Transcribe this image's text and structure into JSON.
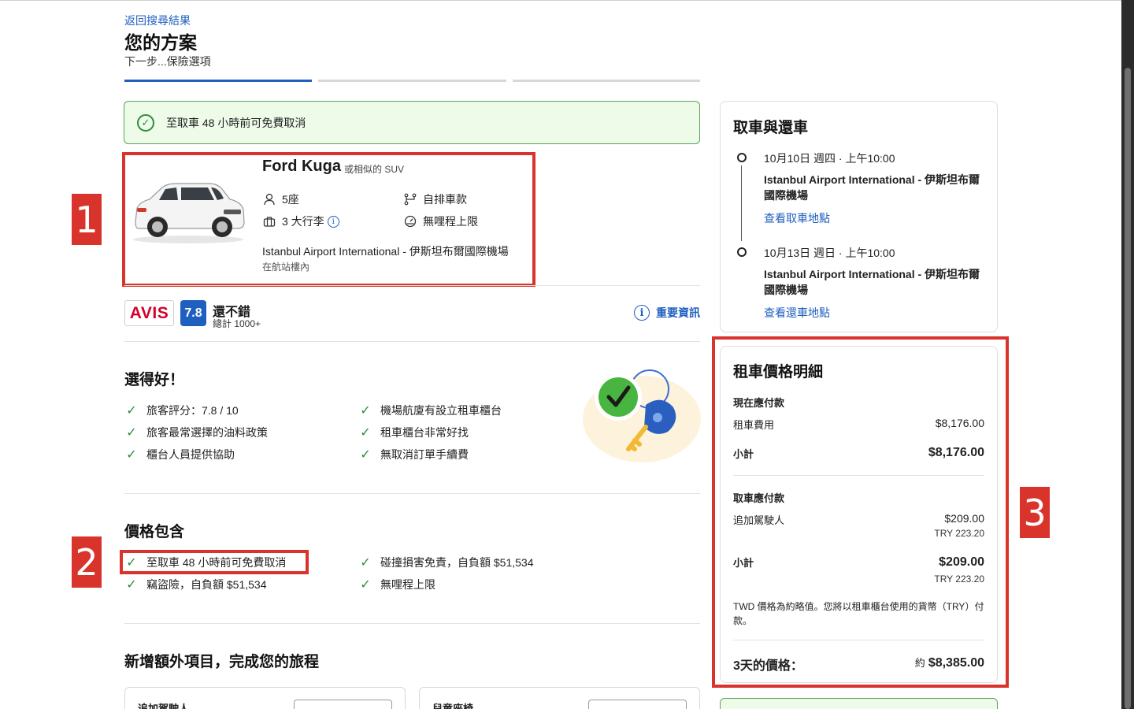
{
  "header": {
    "back_link": "返回搜尋結果",
    "title": "您的方案",
    "next_step": "下一步...保險選項"
  },
  "banner": {
    "text": "至取車 48 小時前可免費取消"
  },
  "car": {
    "name": "Ford Kuga",
    "similar": "或相似的 SUV",
    "seats": "5座",
    "transmission": "自排車款",
    "luggage": "3 大行李",
    "mileage": "無哩程上限",
    "location": "Istanbul Airport International - 伊斯坦布爾國際機場",
    "location_sub": "在航站樓內"
  },
  "supplier": {
    "logo_text": "AVIS",
    "score": "7.8",
    "score_label": "還不錯",
    "review_count": "總計 1000+",
    "important_info": "重要資訊"
  },
  "good_choice": {
    "title": "選得好！",
    "items_left": [
      "旅客評分：7.8 / 10",
      "旅客最常選擇的油料政策",
      "櫃台人員提供協助"
    ],
    "items_right": [
      "機場航廈有設立租車櫃台",
      "租車櫃台非常好找",
      "無取消訂單手續費"
    ]
  },
  "price_includes": {
    "title": "價格包含",
    "items_left": [
      "至取車 48 小時前可免費取消",
      "竊盜險，自負額 $51,534"
    ],
    "items_right": [
      "碰撞損害免責，自負額 $51,534",
      "無哩程上限"
    ]
  },
  "extras": {
    "title": "新增額外項目，完成您的旅程",
    "card1": "追加駕駛人",
    "card2": "兒童座椅"
  },
  "pickup_return": {
    "title": "取車與還車",
    "pickup_date": "10月10日 週四 · 上午10:00",
    "pickup_place": "Istanbul Airport International - 伊斯坦布爾國際機場",
    "pickup_link": "查看取車地點",
    "return_date": "10月13日 週日 · 上午10:00",
    "return_place": "Istanbul Airport International - 伊斯坦布爾國際機場",
    "return_link": "查看還車地點"
  },
  "price_breakdown": {
    "title": "租車價格明細",
    "pay_now": "現在應付款",
    "rental_fee_label": "租車費用",
    "rental_fee": "$8,176.00",
    "subtotal_label": "小計",
    "subtotal_now": "$8,176.00",
    "pay_at_pickup": "取車應付款",
    "extra_driver_label": "追加駕駛人",
    "extra_driver": "$209.00",
    "extra_driver_try": "TRY 223.20",
    "subtotal_pickup": "$209.00",
    "subtotal_pickup_try": "TRY 223.20",
    "note": "TWD 價格為約略值。您將以租車櫃台使用的貨幣（TRY）付款。",
    "total_label": "3天的價格：",
    "total_approx": "約",
    "total": "$8,385.00"
  },
  "annotations": [
    "1",
    "2",
    "3"
  ],
  "colors": {
    "accent": "#1f5fbf",
    "success": "#2e8b3e",
    "annotation": "#d9342b",
    "brand_avis": "#d4002a"
  }
}
